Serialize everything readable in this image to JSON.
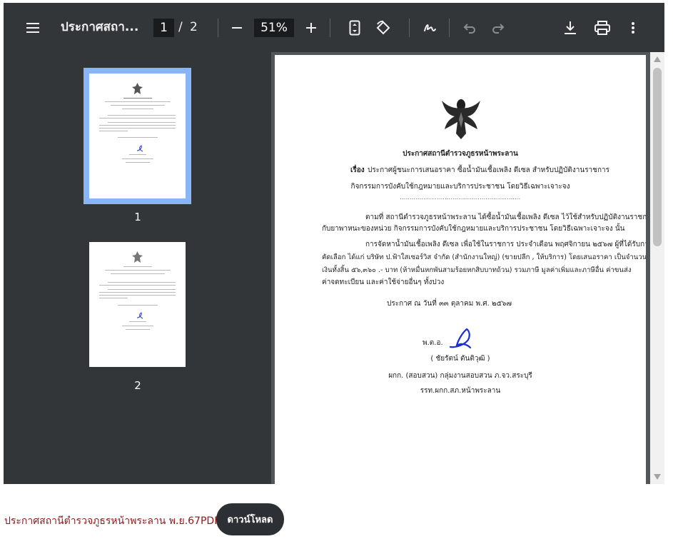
{
  "toolbar": {
    "menu_icon": "menu-icon",
    "title": "ประกาศสถา...",
    "current_page": "1",
    "page_separator": "/",
    "total_pages": "2",
    "zoom": "51%",
    "icons": [
      "zoom-out-icon",
      "zoom-in-icon",
      "fit-page-icon",
      "rotate-icon",
      "annotate-icon",
      "undo-icon",
      "redo-icon",
      "download-icon",
      "print-icon",
      "more-icon"
    ]
  },
  "thumbnails": [
    {
      "label": "1",
      "selected": true
    },
    {
      "label": "2",
      "selected": false
    }
  ],
  "document": {
    "heading": "ประกาศสถานีตำรวจภูธรหน้าพระลาน",
    "subject_label": "เรื่อง",
    "subject_line1": "ประกาศผู้ชนะการเสนอราคา ซื้อน้ำมันเชื้อเพลิง ดีเซล สำหรับปฏิบัติงานราชการ",
    "subject_line2": "กิจกรรมการบังคับใช้กฎหมายและบริการประชาชน โดยวิธีเฉพาะเจาะจง",
    "dots": "..............................................................",
    "para1_line1": "ตามที่ สถานีตำรวจภูธรหน้าพระลาน ได้ซื้อน้ำมันเชื้อเพลิง ดีเซล ไว้ใช้สำหรับปฏิบัติงานราชการ",
    "para1_line2": "กับยาพาหนะของหน่วย กิจกรรมการบังคับใช้กฎหมายและบริการประชาชน โดยวิธีเฉพาะเจาะจง นั้น",
    "para2_line1": "การจัดหาน้ำมันเชื้อเพลิง ดีเซล เพื่อใช้ในราชการ ประจำเดือน พฤศจิกายน ๒๕๖๗ ผู้ที่ได้รับการ",
    "para2_line2": "คัดเลือก ได้แก่ บริษัท ป.ฟ้าใสเซอร์วิส จำกัด (สำนักงานใหญ่) (ขายปลีก , ให้บริการ) โดยเสนอราคา เป็นจำนวน",
    "para2_line3": "เงินทั้งสิ้น ๕๖,๓๖๐ .- บาท (ห้าหมื่นหกพันสามร้อยหกสิบบาทถ้วน) รวมภาษี มูลค่าเพิ่มและภาษีอื่น ค่าขนส่ง",
    "para2_line4": "ค่าจดทะเบียน และค่าใช้จ่ายอื่นๆ ทั้งปวง",
    "date_line": "ประกาศ ณ วันที่ ๓๓ ตุลาคม พ.ศ. ๒๕๖๗",
    "rank": "พ.ต.อ.",
    "signer": "( ชัยรัตน์ ตันติวุฒิ )",
    "position1": "ผกก. (สอบสวน) กลุ่มงานสอบสวน ภ.จว.สระบุรี",
    "position2": "รรท.ผกก.สภ.หน้าพระลาน"
  },
  "footer": {
    "file_link": "ประกาศสถานีตำรวจภูธรหน้าพระลาน พ.ย.67PDF",
    "download_label": "ดาวน์โหลด"
  },
  "colors": {
    "toolbar_bg": "#323639",
    "viewer_bg": "#525659",
    "selection": "#8ab4f8",
    "link": "#8b1a1a",
    "download_bg": "#2c3035",
    "signature": "#1a2fd6"
  }
}
